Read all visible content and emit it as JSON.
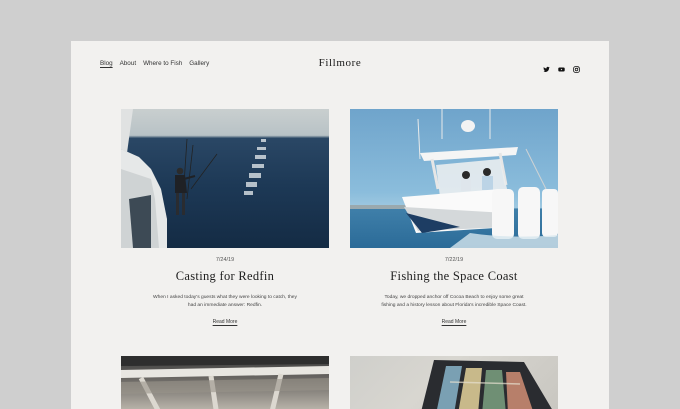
{
  "site": {
    "name": "Fillmore"
  },
  "nav": {
    "items": [
      {
        "label": "Blog",
        "active": true
      },
      {
        "label": "About",
        "active": false
      },
      {
        "label": "Where to Fish",
        "active": false
      },
      {
        "label": "Gallery",
        "active": false
      }
    ]
  },
  "social": {
    "icons": [
      "twitter-icon",
      "youtube-icon",
      "instagram-icon"
    ]
  },
  "posts": [
    {
      "date": "7/24/19",
      "title": "Casting for Redfin",
      "excerpt": "When I asked today's guests what they were looking to catch, they had an immediate answer: Redfin.",
      "more_label": "Read More"
    },
    {
      "date": "7/22/19",
      "title": "Fishing the Space Coast",
      "excerpt": "Today, we dropped anchor off Cocoa Beach to enjoy some great fishing and a history lesson about Florida's incredible Space Coast.",
      "more_label": "Read More"
    }
  ],
  "colors": {
    "page": "#f2f1ef",
    "backdrop": "#cfcfcf",
    "text": "#1d1d1d"
  }
}
